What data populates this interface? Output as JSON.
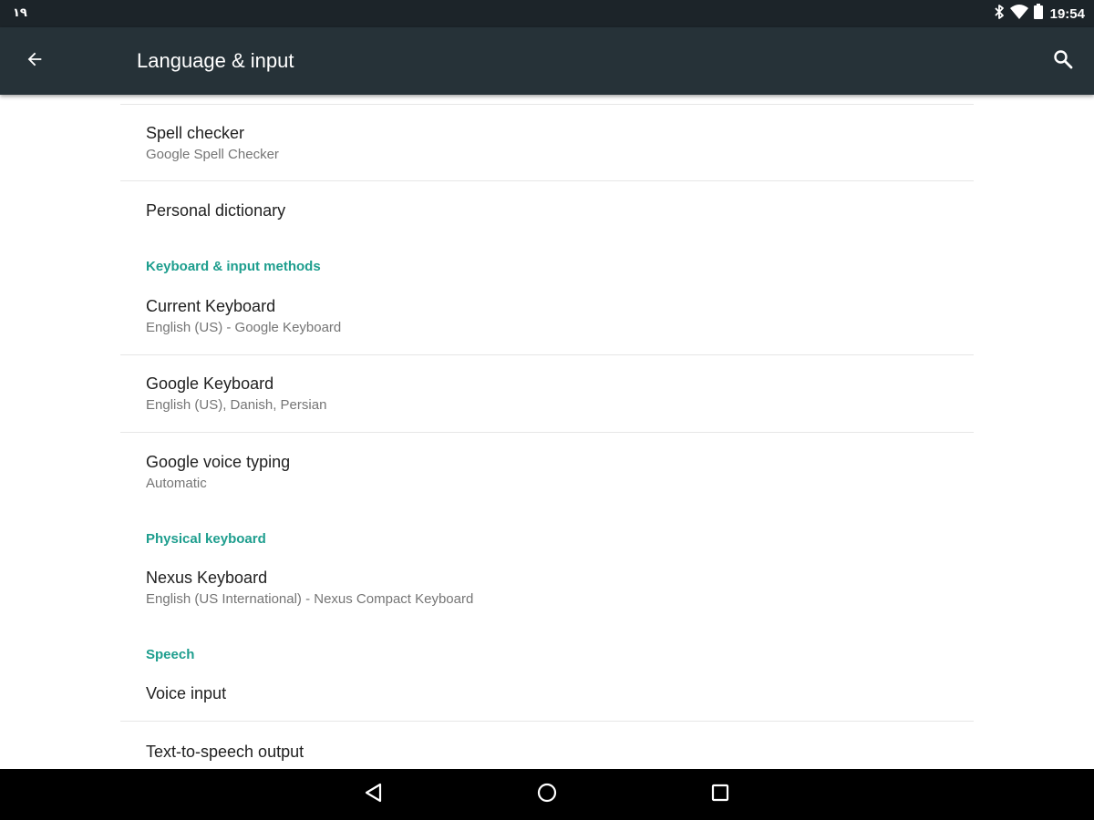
{
  "status_bar": {
    "left_text": "۱۹",
    "time": "19:54",
    "icons": [
      "bluetooth-icon",
      "wifi-icon",
      "battery-icon"
    ]
  },
  "toolbar": {
    "title": "Language & input",
    "back_icon": "arrow-back-icon",
    "search_icon": "search-icon",
    "background": "#263238"
  },
  "accent_color": "#1e9e8e",
  "preferences": {
    "spell_checker": {
      "title": "Spell checker",
      "summary": "Google Spell Checker"
    },
    "personal_dictionary": {
      "title": "Personal dictionary"
    },
    "keyboard_section": {
      "header": "Keyboard & input methods",
      "current_keyboard": {
        "title": "Current Keyboard",
        "summary": "English (US) - Google Keyboard"
      },
      "google_keyboard": {
        "title": "Google Keyboard",
        "summary": "English (US), Danish, Persian"
      },
      "google_voice_typing": {
        "title": "Google voice typing",
        "summary": "Automatic"
      }
    },
    "physical_keyboard_section": {
      "header": "Physical keyboard",
      "nexus_keyboard": {
        "title": "Nexus Keyboard",
        "summary": "English (US International) - Nexus Compact Keyboard"
      }
    },
    "speech_section": {
      "header": "Speech",
      "voice_input": {
        "title": "Voice input"
      },
      "tts_output": {
        "title": "Text-to-speech output"
      }
    }
  },
  "nav_bar": {
    "icons": [
      "back-triangle-icon",
      "home-circle-icon",
      "recents-square-icon"
    ]
  }
}
